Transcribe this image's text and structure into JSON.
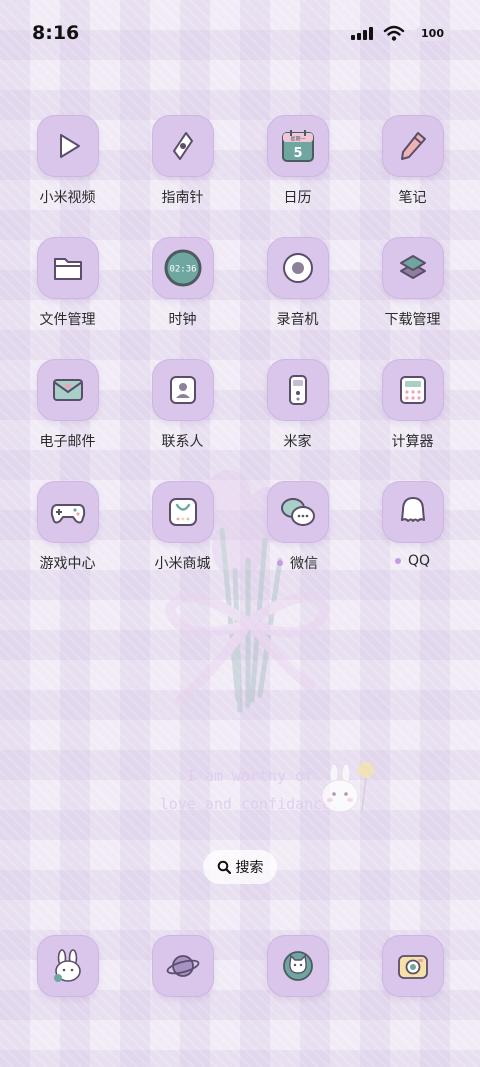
{
  "status": {
    "time": "8:16",
    "battery": "100"
  },
  "apps": [
    {
      "label": "小米视频",
      "icon": "play-icon"
    },
    {
      "label": "指南针",
      "icon": "compass-icon"
    },
    {
      "label": "日历",
      "icon": "calendar-icon",
      "icon_text": "5",
      "icon_subtext": "星期一"
    },
    {
      "label": "笔记",
      "icon": "pencil-icon"
    },
    {
      "label": "文件管理",
      "icon": "folder-icon"
    },
    {
      "label": "时钟",
      "icon": "clock-icon",
      "icon_text": "02:36"
    },
    {
      "label": "录音机",
      "icon": "recorder-icon"
    },
    {
      "label": "下载管理",
      "icon": "layers-icon"
    },
    {
      "label": "电子邮件",
      "icon": "envelope-icon"
    },
    {
      "label": "联系人",
      "icon": "contact-icon"
    },
    {
      "label": "米家",
      "icon": "remote-icon"
    },
    {
      "label": "计算器",
      "icon": "calculator-icon"
    },
    {
      "label": "游戏中心",
      "icon": "gamepad-icon"
    },
    {
      "label": "小米商城",
      "icon": "shop-bag-icon"
    },
    {
      "label": "微信",
      "icon": "chat-bubbles-icon",
      "new_badge": true
    },
    {
      "label": "QQ",
      "icon": "penguin-ghost-icon",
      "new_badge": true
    }
  ],
  "quote": {
    "line1": "I am worthy of",
    "line2": "love and confidance."
  },
  "search": {
    "label": "搜索"
  },
  "dock": [
    {
      "icon": "bunny-icon"
    },
    {
      "icon": "planet-icon"
    },
    {
      "icon": "cat-face-icon"
    },
    {
      "icon": "camera-icon"
    }
  ],
  "colors": {
    "tile": "#d9c6ea",
    "badge_dot": "#c49be8",
    "accent_teal": "#6fa7a0",
    "icon_stroke": "#5a4e6b"
  }
}
